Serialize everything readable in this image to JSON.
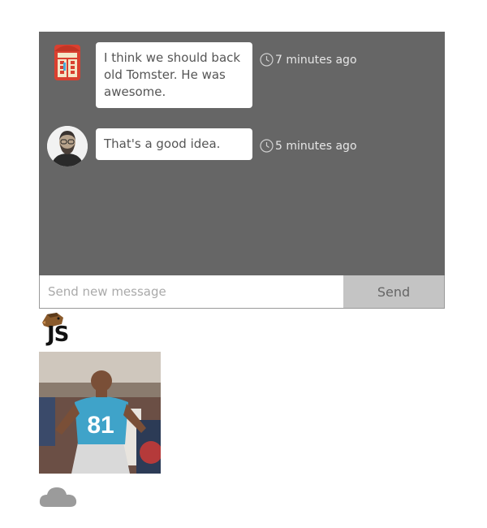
{
  "messages": [
    {
      "text": "I think we should back old Tomster. He was awesome.",
      "time": "7 minutes ago",
      "avatar": "phone-booth-avatar"
    },
    {
      "text": "That's a good idea.",
      "time": "5 minutes ago",
      "avatar": "person-avatar"
    }
  ],
  "composer": {
    "placeholder": "Send new message",
    "send_label": "Send"
  },
  "logo": {
    "text": "JS"
  },
  "photo": {
    "number": "81"
  },
  "icons": {
    "clock": "clock-icon",
    "cloud": "cloud-icon"
  },
  "colors": {
    "panel": "#666666",
    "bubble": "#ffffff",
    "send": "#c4c4c4",
    "meta": "#e6e6e6"
  }
}
